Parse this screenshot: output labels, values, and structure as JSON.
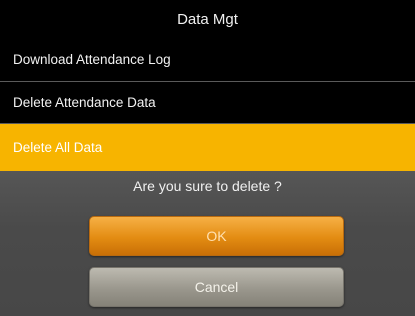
{
  "header": {
    "title": "Data Mgt"
  },
  "menu": {
    "items": [
      {
        "label": "Download Attendance Log"
      },
      {
        "label": "Delete Attendance Data"
      },
      {
        "label": "Delete All Data"
      }
    ],
    "selected_index": 2
  },
  "dialog": {
    "message": "Are you sure to delete ?",
    "ok_label": "OK",
    "cancel_label": "Cancel"
  },
  "colors": {
    "background": "#000000",
    "selection": "#f7b400",
    "ok_button": "#e38c12",
    "cancel_button": "#9a978d",
    "dialog_background": "#4a4a4a"
  }
}
